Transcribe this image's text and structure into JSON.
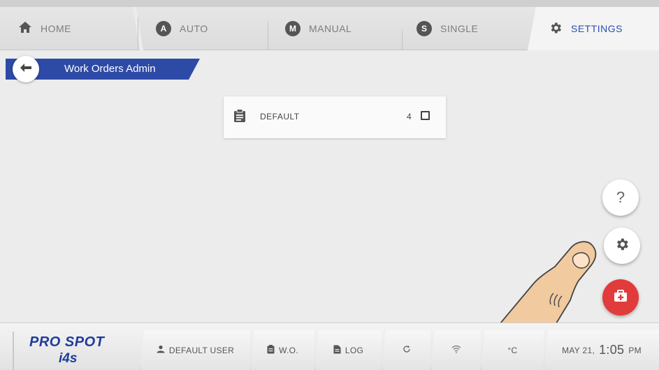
{
  "tabs": {
    "home": "HOME",
    "auto": "AUTO",
    "auto_letter": "A",
    "manual": "MANUAL",
    "manual_letter": "M",
    "single": "SINGLE",
    "single_letter": "S",
    "settings": "SETTINGS",
    "active": "settings"
  },
  "breadcrumb": {
    "title": "Work Orders Admin",
    "back_icon": "arrow-left-icon"
  },
  "work_order": {
    "icon": "clipboard-icon",
    "label": "DEFAULT",
    "count": "4",
    "checked": false
  },
  "fabs": {
    "help_label": "?",
    "settings_icon": "gear-icon",
    "emergency_icon": "medical-kit-icon"
  },
  "statusbar": {
    "logo_text": "PRO SPOT",
    "logo_sub": "i4s",
    "user": "DEFAULT USER",
    "work_order": "W.O.",
    "log": "LOG",
    "refresh_icon": "refresh-icon",
    "wifi_icon": "wifi-icon",
    "temperature": "°C",
    "date": "MAY 21,",
    "time": "1:05",
    "ampm": "PM"
  },
  "colors": {
    "accent_blue": "#2d4aa6",
    "active_tab_text": "#2a4fb3",
    "emergency_red": "#e23b3b"
  }
}
